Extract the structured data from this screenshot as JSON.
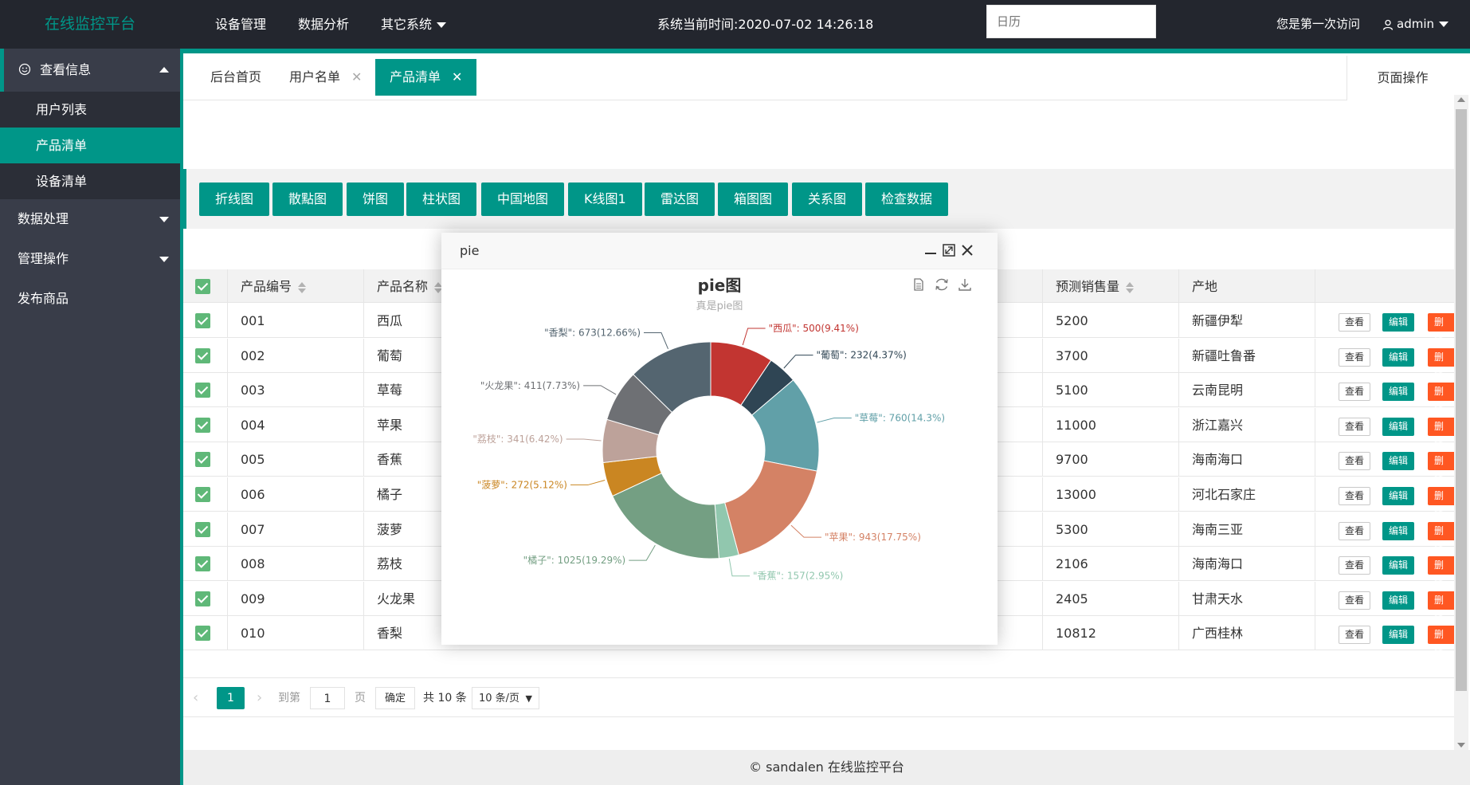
{
  "header": {
    "logo": "在线监控平台",
    "nav": [
      "设备管理",
      "数据分析",
      "其它系统"
    ],
    "time_text": "系统当前时间:2020-07-02 14:26:18",
    "calendar_placeholder": "日历",
    "visit_text": "您是第一次访问",
    "username": "admin"
  },
  "sidebar": {
    "group1": "查看信息",
    "sub_items": [
      "用户列表",
      "产品清单",
      "设备清单"
    ],
    "group2": "数据处理",
    "group3": "管理操作",
    "group4": "发布商品"
  },
  "tabs": [
    "后台首页",
    "用户名单",
    "产品清单"
  ],
  "page_ops": "页面操作",
  "chart_buttons": [
    "折线图",
    "散點图",
    "饼图",
    "柱状图",
    "中国地图",
    "K线图1",
    "雷达图",
    "箱图图",
    "关系图",
    "检查数据"
  ],
  "table": {
    "headers": [
      "产品编号",
      "产品名称",
      "预测销售量",
      "产地"
    ],
    "rows": [
      {
        "id": "001",
        "name": "西瓜",
        "sales": "5200",
        "origin": "新疆伊犁"
      },
      {
        "id": "002",
        "name": "葡萄",
        "sales": "3700",
        "origin": "新疆吐鲁番"
      },
      {
        "id": "003",
        "name": "草莓",
        "sales": "5100",
        "origin": "云南昆明"
      },
      {
        "id": "004",
        "name": "苹果",
        "sales": "11000",
        "origin": "浙江嘉兴"
      },
      {
        "id": "005",
        "name": "香蕉",
        "sales": "9700",
        "origin": "海南海口"
      },
      {
        "id": "006",
        "name": "橘子",
        "sales": "13000",
        "origin": "河北石家庄"
      },
      {
        "id": "007",
        "name": "菠萝",
        "sales": "5300",
        "origin": "海南三亚"
      },
      {
        "id": "008",
        "name": "荔枝",
        "sales": "2106",
        "origin": "海南海口"
      },
      {
        "id": "009",
        "name": "火龙果",
        "sales": "2405",
        "origin": "甘肃天水"
      },
      {
        "id": "010",
        "name": "香梨",
        "sales": "10812",
        "origin": "广西桂林"
      }
    ],
    "btn_view": "查看",
    "btn_edit": "编辑",
    "btn_delete": "删除"
  },
  "pager": {
    "current": "1",
    "goto": "到第",
    "goto_value": "1",
    "page_unit": "页",
    "confirm": "确定",
    "total": "共 10 条",
    "per_page": "10 条/页"
  },
  "footer": "© sandalen 在线监控平台",
  "modal": {
    "title": "pie",
    "colors": {
      "accent": "#009688",
      "danger": "#ff5722",
      "checkbox": "#5fb878",
      "header_bg": "#23262e",
      "sidebar_bg": "#393d49"
    }
  },
  "chart_data": {
    "type": "pie",
    "donut": true,
    "title": "pie图",
    "subtitle": "真是pie图",
    "slices": [
      {
        "name": "西瓜",
        "value": 500,
        "label": "\"西瓜\": 500(9.41%)",
        "color": "#c23531"
      },
      {
        "name": "葡萄",
        "value": 232,
        "label": "\"葡萄\": 232(4.37%)",
        "color": "#2f4554"
      },
      {
        "name": "草莓",
        "value": 760,
        "label": "\"草莓\": 760(14.3%)",
        "color": "#61a0a8"
      },
      {
        "name": "苹果",
        "value": 943,
        "label": "\"苹果\": 943(17.75%)",
        "color": "#d48265"
      },
      {
        "name": "香蕉",
        "value": 157,
        "label": "\"香蕉\": 157(2.95%)",
        "color": "#91c7ae"
      },
      {
        "name": "橘子",
        "value": 1025,
        "label": "\"橘子\": 1025(19.29%)",
        "color": "#749f83"
      },
      {
        "name": "菠萝",
        "value": 272,
        "label": "\"菠萝\": 272(5.12%)",
        "color": "#ca8622"
      },
      {
        "name": "荔枝",
        "value": 341,
        "label": "\"荔枝\": 341(6.42%)",
        "color": "#bda29a"
      },
      {
        "name": "火龙果",
        "value": 411,
        "label": "\"火龙果\": 411(7.73%)",
        "color": "#6e7074"
      },
      {
        "name": "香梨",
        "value": 673,
        "label": "\"香梨\": 673(12.66%)",
        "color": "#546570"
      }
    ]
  }
}
